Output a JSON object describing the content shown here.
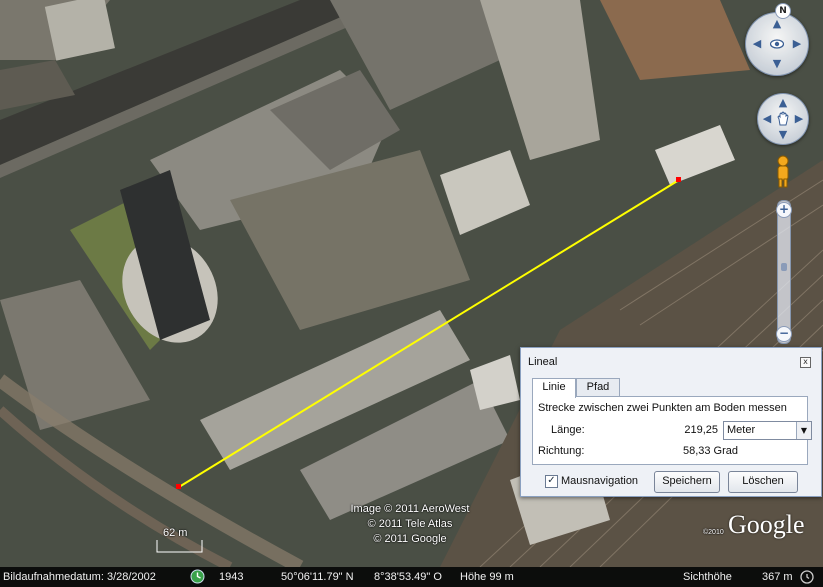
{
  "map": {
    "type": "satellite imagery",
    "measure_line_color": "#ffff00",
    "endpoint_color": "#ff0000"
  },
  "scale": {
    "label": "62  m"
  },
  "copyright": [
    "Image © 2011 AeroWest",
    "© 2011 Tele Atlas",
    "© 2011 Google"
  ],
  "brand": "Google",
  "brand_small": "©2010",
  "compass": {
    "north": "N"
  },
  "nav_icons": [
    "eye-look-icon",
    "hand-move-icon",
    "pegman-icon"
  ],
  "zoom": {
    "plus": "+",
    "minus": "−"
  },
  "dialog": {
    "title": "Lineal",
    "close": "x",
    "tabs": [
      {
        "label": "Linie",
        "active": true
      },
      {
        "label": "Pfad",
        "active": false
      }
    ],
    "description": "Strecke zwischen zwei Punkten am Boden messen",
    "length_label": "Länge:",
    "length_value": "219,25",
    "unit": "Meter",
    "direction_label": "Richtung:",
    "direction_value": "58,33 Grad",
    "mouse_nav_label": "Mausnavigation",
    "mouse_nav_checked": true,
    "save_label": "Speichern",
    "delete_label": "Löschen"
  },
  "status": {
    "image_date": "Bildaufnahmedatum: 3/28/2002",
    "year": "1943",
    "lat": "50°06'11.79\" N",
    "lon": "8°38'53.49\" O",
    "elevation": "Höhe   99 m",
    "eye_label": "Sichthöhe",
    "eye_value": "367 m"
  }
}
